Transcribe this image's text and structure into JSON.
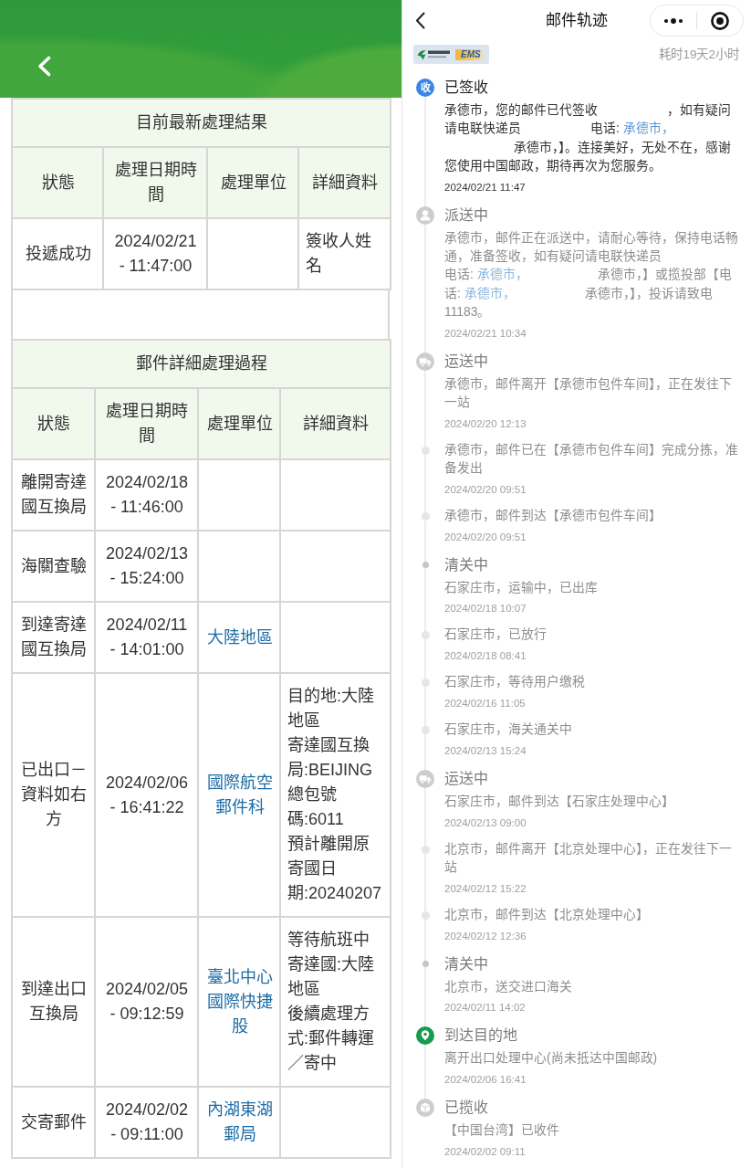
{
  "postal_page": {
    "tables": [
      {
        "title": "目前最新處理結果",
        "columns": [
          "狀態",
          "處理日期時間",
          "處理單位",
          "詳細資料"
        ],
        "rows": [
          {
            "status": "投遞成功",
            "time": "2024/02/21 - 11:47:00",
            "detail": [
              "簽收人姓名"
            ]
          }
        ]
      },
      {
        "title": "郵件詳細處理過程",
        "columns": [
          "狀態",
          "處理日期時間",
          "處理單位",
          "詳細資料"
        ],
        "rows": [
          {
            "status": "離開寄達國互換局",
            "time": "2024/02/18 - 11:46:00"
          },
          {
            "status": "海關查驗",
            "time": "2024/02/13 - 15:24:00"
          },
          {
            "status": "到達寄達國互換局",
            "time": "2024/02/11 - 14:01:00",
            "unit": "大陸地區"
          },
          {
            "status": "已出口－資料如右方",
            "time": "2024/02/06 - 16:41:22",
            "unit": "國際航空郵件科",
            "detail": [
              "目的地:大陸地區",
              "寄達國互換局:BEIJING",
              "總包號碼:6011",
              "預計離開原寄國日期:20240207"
            ]
          },
          {
            "status": "到達出口互換局",
            "time": "2024/02/05 - 09:12:59",
            "unit": "臺北中心國際快捷股",
            "detail": [
              "等待航班中",
              "寄達國:大陸地區",
              "後續處理方式:郵件轉運／寄中"
            ]
          },
          {
            "status": "交寄郵件",
            "time": "2024/02/02 - 09:11:00",
            "unit": "內湖東湖郵局"
          }
        ]
      }
    ]
  },
  "tracking_page": {
    "title": "邮件轨迹",
    "logo_text": "EMS",
    "elapsed": "耗时19天2小时",
    "events": [
      {
        "title": "已签收",
        "marker": {
          "kind": "badge",
          "text": "收"
        },
        "current": true,
        "body": [
          {
            "kind": "text",
            "text": "承德市，您的邮件已代签收"
          },
          {
            "kind": "redacted"
          },
          {
            "kind": "text",
            "text": "，如有疑问请电联快递员"
          },
          {
            "kind": "redacted"
          },
          {
            "kind": "text",
            "text": "电话: "
          },
          {
            "kind": "link",
            "text": "承德市，"
          },
          {
            "kind": "redacted"
          },
          {
            "kind": "text",
            "text": "承德市，】。连接美好，无处不在，感谢您使用中国邮政，期待再次为您服务。"
          }
        ],
        "time": "2024/02/21 11:47"
      },
      {
        "title": "派送中",
        "marker": {
          "kind": "courier"
        },
        "current": false,
        "body": [
          {
            "kind": "text",
            "text": "承德市，邮件正在派送中，请耐心等待，保持电话畅通，准备签收，如有疑问请电联快递员"
          },
          {
            "kind": "redacted"
          },
          {
            "kind": "text",
            "text": "电话: "
          },
          {
            "kind": "link",
            "text": "承德市，"
          },
          {
            "kind": "redacted"
          },
          {
            "kind": "text",
            "text": "承德市，】或揽投部【电话: "
          },
          {
            "kind": "link",
            "text": "承德市，"
          },
          {
            "kind": "redacted"
          },
          {
            "kind": "text",
            "text": "承德市，】，投诉请致电11183。"
          }
        ],
        "time": "2024/02/21 10:34"
      },
      {
        "title": "运送中",
        "marker": {
          "kind": "transport"
        },
        "current": false,
        "body": [
          {
            "kind": "text",
            "text": "承德市，邮件离开【承德市包件车间】，正在发往下一站"
          }
        ],
        "time": "2024/02/20 12:13"
      },
      {
        "marker": {
          "kind": "step"
        },
        "current": false,
        "body": [
          {
            "kind": "text",
            "text": "承德市，邮件已在【承德市包件车间】完成分拣，准备发出"
          }
        ],
        "time": "2024/02/20 09:51"
      },
      {
        "marker": {
          "kind": "step"
        },
        "current": false,
        "body": [
          {
            "kind": "text",
            "text": "承德市，邮件到达【承德市包件车间】"
          }
        ],
        "time": "2024/02/20 09:51"
      },
      {
        "title": "清关中",
        "marker": {
          "kind": "dot"
        },
        "current": false,
        "body": [
          {
            "kind": "text",
            "text": "石家庄市，运输中，已出库"
          }
        ],
        "time": "2024/02/18 10:07"
      },
      {
        "marker": {
          "kind": "step"
        },
        "current": false,
        "body": [
          {
            "kind": "text",
            "text": "石家庄市，已放行"
          }
        ],
        "time": "2024/02/18 08:41"
      },
      {
        "marker": {
          "kind": "step"
        },
        "current": false,
        "body": [
          {
            "kind": "text",
            "text": "石家庄市，等待用户缴税"
          }
        ],
        "time": "2024/02/16 11:05"
      },
      {
        "marker": {
          "kind": "step"
        },
        "current": false,
        "body": [
          {
            "kind": "text",
            "text": "石家庄市，海关通关中"
          }
        ],
        "time": "2024/02/13 15:24"
      },
      {
        "title": "运送中",
        "marker": {
          "kind": "transport"
        },
        "current": false,
        "body": [
          {
            "kind": "text",
            "text": "石家庄市，邮件到达【石家庄处理中心】"
          }
        ],
        "time": "2024/02/13 09:00"
      },
      {
        "marker": {
          "kind": "step"
        },
        "current": false,
        "body": [
          {
            "kind": "text",
            "text": "北京市，邮件离开【北京处理中心】，正在发往下一站"
          }
        ],
        "time": "2024/02/12 15:22"
      },
      {
        "marker": {
          "kind": "step"
        },
        "current": false,
        "body": [
          {
            "kind": "text",
            "text": "北京市，邮件到达【北京处理中心】"
          }
        ],
        "time": "2024/02/12 12:36"
      },
      {
        "title": "清关中",
        "marker": {
          "kind": "dot"
        },
        "current": false,
        "body": [
          {
            "kind": "text",
            "text": "北京市，送交进口海关"
          }
        ],
        "time": "2024/02/11 14:02"
      },
      {
        "title": "到达目的地",
        "marker": {
          "kind": "destination"
        },
        "current": false,
        "body": [
          {
            "kind": "text",
            "text": "离开出口处理中心(尚未抵达中国邮政)"
          }
        ],
        "time": "2024/02/06 16:41"
      },
      {
        "title": "已揽收",
        "marker": {
          "kind": "collected"
        },
        "current": false,
        "body": [
          {
            "kind": "text",
            "text": "【中国台湾】已收件"
          }
        ],
        "time": "2024/02/02 09:11"
      }
    ]
  }
}
